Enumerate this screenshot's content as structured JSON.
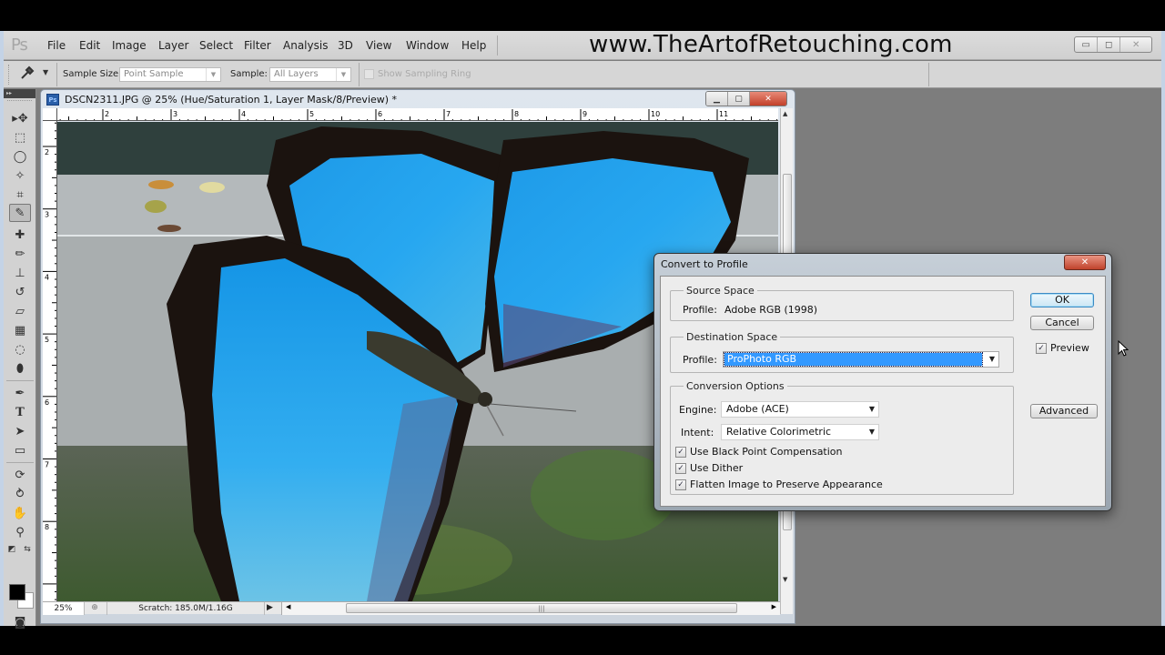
{
  "app": {
    "logo": "Ps",
    "watermark": "www.TheArtofRetouching.com",
    "window_buttons": {
      "minimize": "▭",
      "restore": "◻",
      "close": "✕"
    }
  },
  "menu": [
    "File",
    "Edit",
    "Image",
    "Layer",
    "Select",
    "Filter",
    "Analysis",
    "3D",
    "View",
    "Window",
    "Help"
  ],
  "options_bar": {
    "tool_icon": "eyedropper-icon",
    "sample_size_label": "Sample Size:",
    "sample_size_value": "Point Sample",
    "sample_label": "Sample:",
    "sample_value": "All Layers",
    "show_sampling_ring_label": "Show Sampling Ring",
    "show_sampling_ring_checked": false
  },
  "toolbox": {
    "collapse_glyph": "▸▸",
    "tools": [
      {
        "name": "move-tool",
        "glyph": "▸✥"
      },
      {
        "name": "marquee-tool",
        "glyph": "⬚"
      },
      {
        "name": "lasso-tool",
        "glyph": "◯"
      },
      {
        "name": "quick-selection-tool",
        "glyph": "✧"
      },
      {
        "name": "crop-tool",
        "glyph": "⌗"
      },
      {
        "name": "eyedropper-tool",
        "glyph": "✎",
        "active": true
      },
      {
        "name": "healing-brush-tool",
        "glyph": "✚"
      },
      {
        "name": "brush-tool",
        "glyph": "✏"
      },
      {
        "name": "clone-stamp-tool",
        "glyph": "⊥"
      },
      {
        "name": "history-brush-tool",
        "glyph": "↺"
      },
      {
        "name": "eraser-tool",
        "glyph": "▱"
      },
      {
        "name": "gradient-tool",
        "glyph": "▦"
      },
      {
        "name": "blur-tool",
        "glyph": "◌"
      },
      {
        "name": "dodge-tool",
        "glyph": "⬮"
      },
      {
        "name": "pen-tool",
        "glyph": "✒"
      },
      {
        "name": "type-tool",
        "glyph": "T"
      },
      {
        "name": "path-selection-tool",
        "glyph": "➤"
      },
      {
        "name": "shape-tool",
        "glyph": "▭"
      },
      {
        "name": "3d-rotate-tool",
        "glyph": "⟳"
      },
      {
        "name": "3d-orbit-tool",
        "glyph": "⥁"
      },
      {
        "name": "hand-tool",
        "glyph": "✋"
      },
      {
        "name": "zoom-tool",
        "glyph": "⚲"
      }
    ],
    "default_colors_glyph": "◩",
    "swap_colors_glyph": "⇆",
    "foreground_color": "#000000",
    "background_color": "#ffffff",
    "quick_mask_glyph": "◙"
  },
  "document": {
    "title": "DSCN2311.JPG @ 25% (Hue/Saturation 1, Layer Mask/8/Preview) *",
    "icon": "Ps",
    "ruler_h": [
      "2",
      "3",
      "4",
      "5",
      "6",
      "7",
      "8",
      "9",
      "10",
      "11"
    ],
    "ruler_v": [
      "2",
      "3",
      "4",
      "5",
      "6",
      "7",
      "8"
    ],
    "zoom": "25%",
    "scratch": "Scratch: 185.0M/1.16G"
  },
  "dialog": {
    "title": "Convert to Profile",
    "close_glyph": "✕",
    "source_space": {
      "legend": "Source Space",
      "profile_label": "Profile:",
      "profile_value": "Adobe RGB (1998)"
    },
    "destination_space": {
      "legend": "Destination Space",
      "profile_label": "Profile:",
      "profile_value": "ProPhoto RGB"
    },
    "conversion_options": {
      "legend": "Conversion Options",
      "engine_label": "Engine:",
      "engine_value": "Adobe (ACE)",
      "intent_label": "Intent:",
      "intent_value": "Relative Colorimetric",
      "checkboxes": [
        {
          "label": "Use Black Point Compensation",
          "checked": true
        },
        {
          "label": "Use Dither",
          "checked": true
        },
        {
          "label": "Flatten Image to Preserve Appearance",
          "checked": true
        }
      ]
    },
    "buttons": {
      "ok": "OK",
      "cancel": "Cancel",
      "advanced": "Advanced"
    },
    "preview_label": "Preview",
    "preview_checked": true,
    "check_glyph": "✓"
  }
}
